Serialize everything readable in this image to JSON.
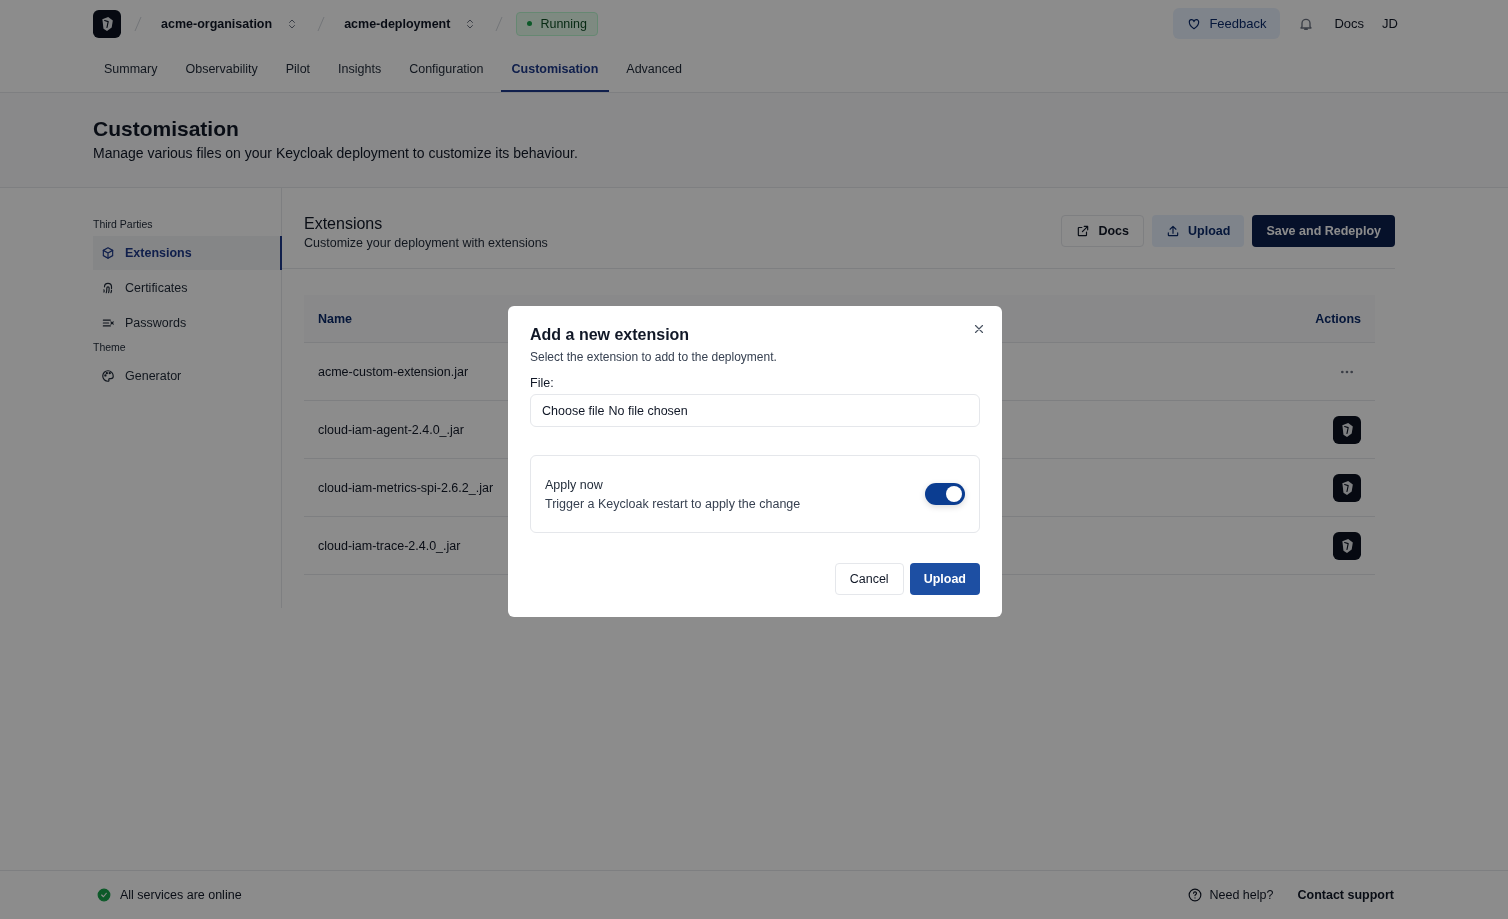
{
  "topbar": {
    "breadcrumbs": [
      {
        "label": "acme-organisation"
      },
      {
        "label": "acme-deployment"
      }
    ],
    "status": {
      "label": "Running"
    },
    "feedback": "Feedback",
    "docs": "Docs",
    "user": "JD"
  },
  "tabs": [
    {
      "label": "Summary",
      "selected": false
    },
    {
      "label": "Observability",
      "selected": false
    },
    {
      "label": "Pilot",
      "selected": false
    },
    {
      "label": "Insights",
      "selected": false
    },
    {
      "label": "Configuration",
      "selected": false
    },
    {
      "label": "Customisation",
      "selected": true
    },
    {
      "label": "Advanced",
      "selected": false
    }
  ],
  "page_header": {
    "title": "Customisation",
    "subtitle": "Manage various files on your Keycloak deployment to customize its behaviour."
  },
  "sidebar": [
    {
      "heading": "Third Parties",
      "items": [
        {
          "label": "Extensions",
          "kind": "cube",
          "selected": true
        },
        {
          "label": "Certificates",
          "kind": "fingerprint",
          "selected": false
        },
        {
          "label": "Passwords",
          "kind": "lines",
          "selected": false
        }
      ]
    },
    {
      "heading": "Theme",
      "items": [
        {
          "label": "Generator",
          "kind": "palette",
          "selected": false
        }
      ]
    }
  ],
  "section": {
    "title": "Extensions",
    "subtitle": "Customize your deployment with extensions",
    "buttons": [
      {
        "label": "Docs",
        "kind": "outline"
      },
      {
        "label": "Upload",
        "kind": "soft"
      },
      {
        "label": "Save and Redeploy",
        "kind": "primary"
      }
    ]
  },
  "table": {
    "columns": [
      "Name",
      "Actions"
    ],
    "rows": [
      {
        "name": "acme-custom-extension.jar",
        "kind": "menu"
      },
      {
        "name": "cloud-iam-agent-2.4.0_.jar",
        "kind": "logo"
      },
      {
        "name": "cloud-iam-metrics-spi-2.6.2_.jar",
        "kind": "logo"
      },
      {
        "name": "cloud-iam-trace-2.4.0_.jar",
        "kind": "logo"
      }
    ]
  },
  "modal": {
    "title": "Add a new extension",
    "subtitle": "Select the extension to add to the deployment.",
    "file_label": "File:",
    "file_button": "Choose file",
    "file_status": "No file chosen",
    "toggle": {
      "label": "Apply now",
      "description": "Trigger a Keycloak restart to apply the change",
      "on": true
    },
    "buttons": [
      {
        "label": "Cancel",
        "kind": "outline"
      },
      {
        "label": "Upload",
        "kind": "primary"
      }
    ]
  },
  "footer": {
    "status": "All services are online",
    "help": "Need help?",
    "contact": "Contact support"
  }
}
